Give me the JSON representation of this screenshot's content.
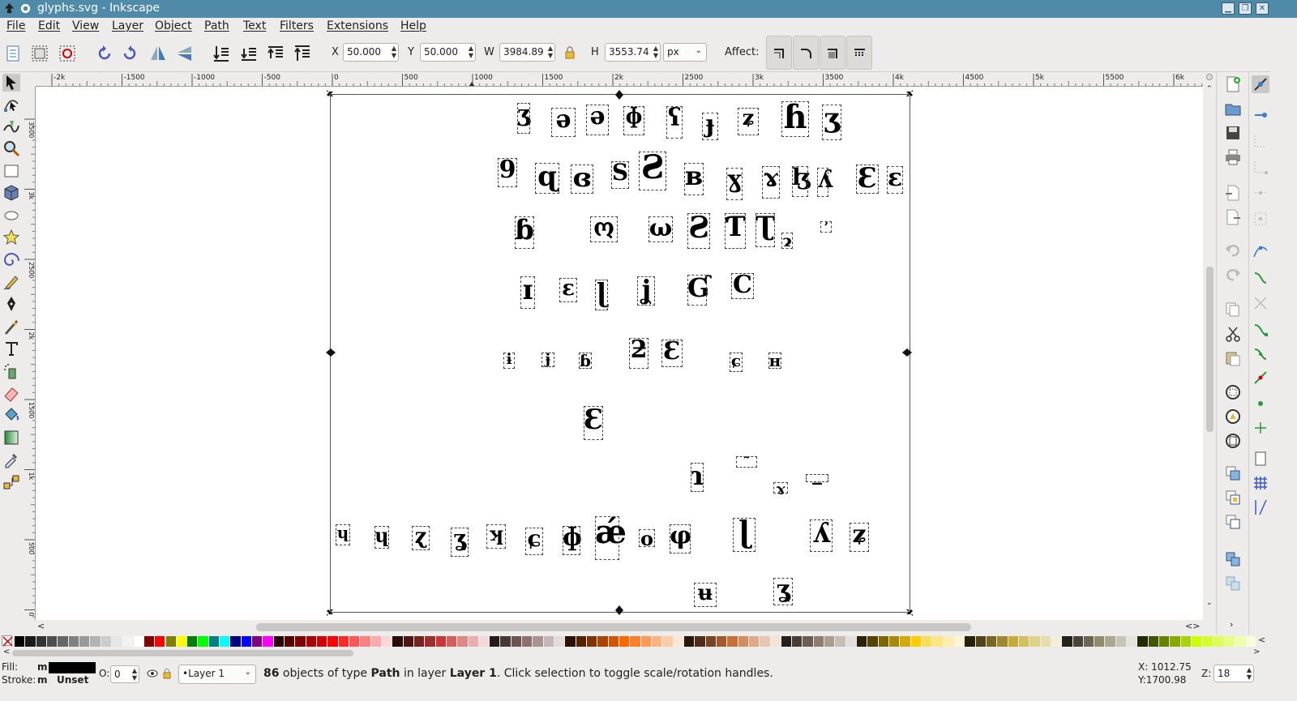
{
  "window": {
    "title": "glyphs.svg - Inkscape",
    "app_icon": "inkscape-icon",
    "controls": [
      "minimize-icon",
      "restore-icon",
      "close-icon"
    ]
  },
  "menu": [
    {
      "label": "File"
    },
    {
      "label": "Edit"
    },
    {
      "label": "View"
    },
    {
      "label": "Layer"
    },
    {
      "label": "Object"
    },
    {
      "label": "Path"
    },
    {
      "label": "Text"
    },
    {
      "label": "Filters"
    },
    {
      "label": "Extensions"
    },
    {
      "label": "Help"
    }
  ],
  "controls": {
    "x_label": "X",
    "x_value": "50.000",
    "y_label": "Y",
    "y_value": "50.000",
    "w_label": "W",
    "w_value": "3984.89",
    "h_label": "H",
    "h_value": "3553.74",
    "unit": "px",
    "affect_label": "Affect:"
  },
  "ruler": {
    "h_labels": [
      "-2k",
      "-1500",
      "-1000",
      "-500",
      "0",
      "500",
      "1000",
      "1500",
      "2k",
      "2500",
      "3k",
      "3500",
      "4k",
      "4500",
      "5k",
      "5500",
      "6k"
    ],
    "v_labels": [
      "3500",
      "3k",
      "2500",
      "2k",
      "1500",
      "1k",
      "500",
      "0"
    ]
  },
  "canvas": {
    "glyphs": [
      "ʒ",
      "ə",
      "ə",
      "ɸ",
      "ʕ",
      "ɟ",
      "ʑ",
      "ɦ",
      "ʒ",
      "9",
      "ɋ",
      "ɞ",
      "S",
      "Ƨ",
      "ʙ",
      "ɣ",
      "ɤ",
      "ɮ",
      "ʎ",
      "Ɛ",
      "ɛ",
      "ɓ",
      "ო",
      "ω",
      "Ƨ",
      "Ƭ",
      "Ʈ",
      "ɂ",
      "ʼ",
      "ɪ",
      "ɛ",
      "ɭ",
      "ʝ",
      "Ɠ",
      "C",
      "ɨ",
      "ɉ",
      "ɓ",
      "ƻ",
      "Ɛ",
      "ɕ",
      "ʜ",
      "Ɛ",
      "ɿ",
      "˜",
      "ɤ",
      "‒",
      "ɥ",
      "ɥ",
      "ɀ",
      "ʓ",
      "ʞ",
      "ɕ",
      "ɸ",
      "ǽ",
      "o",
      "φ",
      "ɭ",
      "ʎ",
      "ʑ",
      "ʉ",
      "ʓ"
    ]
  },
  "status": {
    "fill_label": "Fill:",
    "fill_value": "m",
    "stroke_label": "Stroke:",
    "stroke_value": "m",
    "stroke_unset": "Unset",
    "opacity_label": "O:",
    "opacity_value": "0",
    "layer": "•Layer 1",
    "msg_count": "86",
    "msg_part1": " objects of type ",
    "msg_type": "Path",
    "msg_part2": " in layer ",
    "msg_layer": "Layer 1",
    "msg_part3": ". Click selection to toggle scale/rotation handles.",
    "cursor_x": "X: 1012.75",
    "cursor_y": "Y:1700.98",
    "zoom_label": "Z:",
    "zoom_value": "18"
  },
  "palette_colors": [
    "#000000",
    "#1a1a1a",
    "#333333",
    "#4d4d4d",
    "#666666",
    "#808080",
    "#999999",
    "#b3b3b3",
    "#cccccc",
    "#e6e6e6",
    "#f2f2f2",
    "#ffffff",
    "#800000",
    "#ff0000",
    "#808000",
    "#ffff00",
    "#008000",
    "#00ff00",
    "#008080",
    "#00ffff",
    "#000080",
    "#0000ff",
    "#800080",
    "#ff00ff",
    "#2b0000",
    "#550000",
    "#800000",
    "#aa0000",
    "#d40000",
    "#ff0000",
    "#ff2a2a",
    "#ff5555",
    "#ff8080",
    "#ffaaaa",
    "#ffd5d5",
    "#280b0b",
    "#501616",
    "#782121",
    "#a02c2c",
    "#c83737",
    "#d35f5f",
    "#de8787",
    "#e9afaf",
    "#f4d7d7",
    "#241c1c",
    "#483737",
    "#6c5353",
    "#916f6f",
    "#ac9393",
    "#c8b7b7",
    "#e3dbdb",
    "#2b1100",
    "#552200",
    "#803300",
    "#aa4400",
    "#d45500",
    "#ff6600",
    "#ff7f2a",
    "#ff9955",
    "#ffb380",
    "#ffccaa",
    "#ffe6d5",
    "#28170b",
    "#502d16",
    "#784421",
    "#a05a2c",
    "#c87137",
    "#d38d5f",
    "#deaa87",
    "#e9c6af",
    "#f4e3d7",
    "#241f1c",
    "#483e37",
    "#6c5d53",
    "#917c6f",
    "#ac9d93",
    "#c8beb7",
    "#e3dedb",
    "#2b2200",
    "#554400",
    "#806600",
    "#aa8800",
    "#d4aa00",
    "#ffcc00",
    "#ffdd55",
    "#ffe680",
    "#ffeeaa",
    "#fff6d5",
    "#28220b",
    "#504416",
    "#786721",
    "#a0892c",
    "#c8ab37",
    "#d4c05f",
    "#ded287",
    "#e9ddaf",
    "#f4eed7",
    "#24221c",
    "#484537",
    "#6c6753",
    "#918a6f",
    "#aca793",
    "#c8c4b7",
    "#e3e2db",
    "#222b00",
    "#445500",
    "#668000",
    "#88aa00",
    "#aad400",
    "#ccff00",
    "#d4ff2a",
    "#ddff55",
    "#e5ff80",
    "#eeffaa",
    "#f6ffd5"
  ]
}
